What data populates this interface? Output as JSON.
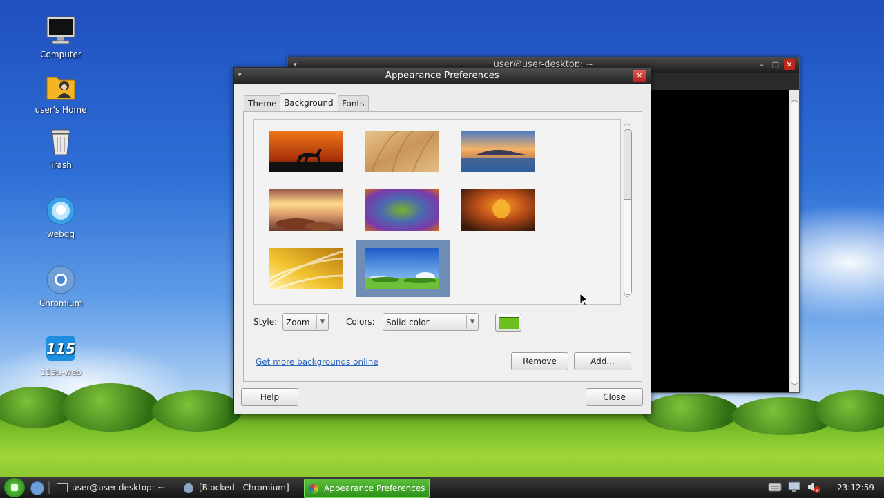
{
  "desktop": {
    "icons": [
      {
        "label": "Computer",
        "icon": "computer-icon"
      },
      {
        "label": "user's Home",
        "icon": "home-folder-icon"
      },
      {
        "label": "Trash",
        "icon": "trash-icon"
      },
      {
        "label": "webqq",
        "icon": "webqq-icon"
      },
      {
        "label": "Chromium",
        "icon": "chromium-icon"
      },
      {
        "label": "115u-web",
        "icon": "115u-web-icon"
      }
    ]
  },
  "terminal": {
    "title": "user@user-desktop: ~"
  },
  "dialog": {
    "title": "Appearance Preferences",
    "tabs": [
      {
        "label": "Theme"
      },
      {
        "label": "Background",
        "active": true
      },
      {
        "label": "Fonts"
      }
    ],
    "gallery": {
      "thumbnails": [
        {
          "name": "horse-sunset",
          "colors": [
            "#e8781a",
            "#7a2a08"
          ]
        },
        {
          "name": "wheat-field",
          "colors": [
            "#d9b27a",
            "#b88a4f"
          ]
        },
        {
          "name": "lake-mountain",
          "colors": [
            "#f0b46a",
            "#2d5a9a"
          ]
        },
        {
          "name": "rocky-sunset",
          "colors": [
            "#f2c27a",
            "#8a4a2a"
          ]
        },
        {
          "name": "color-swirl",
          "colors": [
            "#6a3aa8",
            "#5a9a2a"
          ]
        },
        {
          "name": "tulip",
          "colors": [
            "#e08a1a",
            "#7a2a1a"
          ]
        },
        {
          "name": "golden-petals",
          "colors": [
            "#f5d34a",
            "#c98a14"
          ]
        },
        {
          "name": "green-hills",
          "colors": [
            "#2f6fd0",
            "#6cc03a"
          ],
          "selected": true
        }
      ]
    },
    "style": {
      "label": "Style:",
      "value": "Zoom"
    },
    "colors": {
      "label": "Colors:",
      "value": "Solid color",
      "swatch": "#6cc11f"
    },
    "more_link": "Get more backgrounds online",
    "remove_label": "Remove",
    "add_label": "Add...",
    "help_label": "Help",
    "close_label": "Close"
  },
  "taskbar": {
    "items": [
      {
        "label": "user@user-desktop: ~"
      },
      {
        "label": "[Blocked - Chromium]"
      },
      {
        "label": "Appearance Preferences",
        "active": true
      }
    ],
    "clock": "23:12:59"
  }
}
